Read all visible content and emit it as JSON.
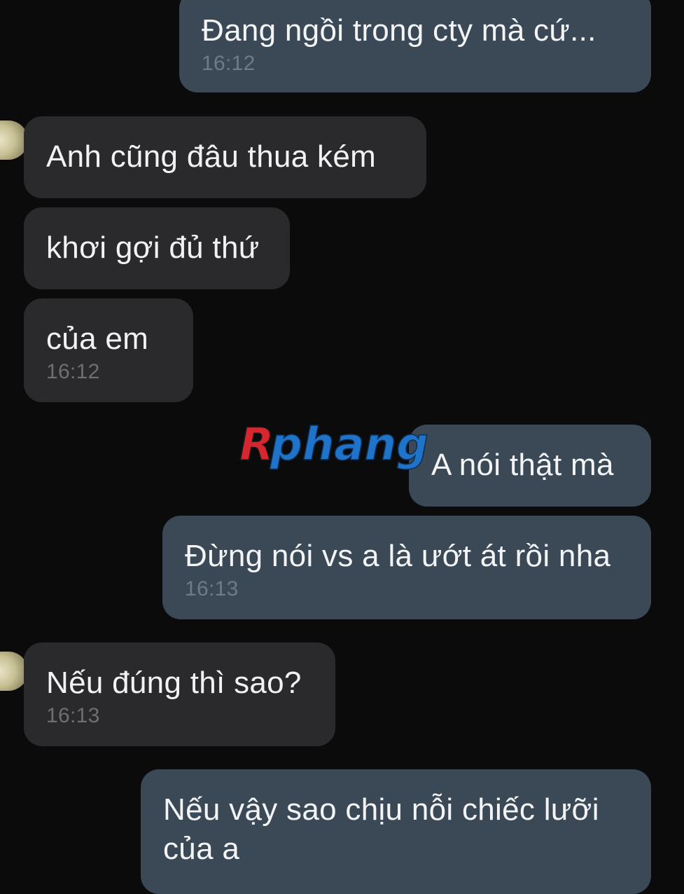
{
  "messages": [
    {
      "side": "out",
      "text": "Đang ngồi trong cty mà cứ...",
      "time": "16:12"
    },
    {
      "side": "in",
      "text": "Anh cũng đâu thua kém",
      "time": ""
    },
    {
      "side": "in",
      "text": "khơi gợi đủ thứ",
      "time": ""
    },
    {
      "side": "in",
      "text": "của em",
      "time": "16:12"
    },
    {
      "side": "out",
      "text": "A nói thật mà",
      "time": ""
    },
    {
      "side": "out",
      "text": "Đừng nói vs a là ướt át rồi nha",
      "time": "16:13"
    },
    {
      "side": "in",
      "text": "Nếu đúng thì sao?",
      "time": "16:13"
    },
    {
      "side": "out",
      "text": "Nếu vậy sao chịu nỗi chiếc lưỡi của a",
      "time": ""
    }
  ],
  "watermark": {
    "text": "Rphang",
    "first_letter": "R",
    "rest": "phang",
    "colors": {
      "first": "#d7262e",
      "rest": "#1f73c9"
    }
  },
  "colors": {
    "background": "#0b0b0c",
    "incoming_bubble": "#2a2a2c",
    "outgoing_bubble": "#3b4856"
  }
}
